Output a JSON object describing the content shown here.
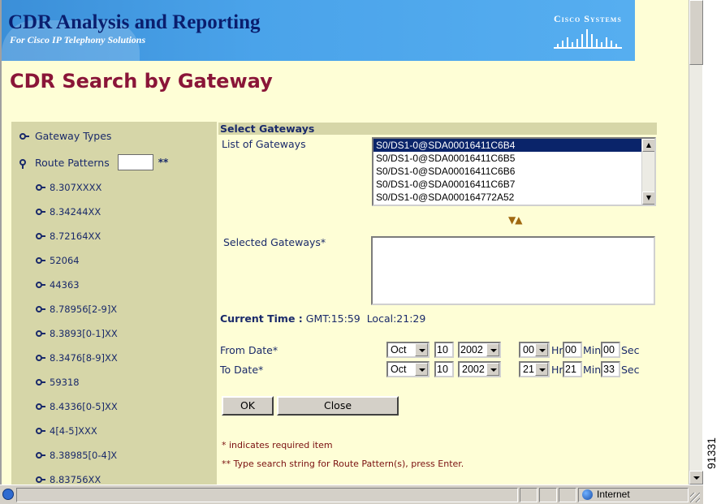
{
  "banner": {
    "title": "CDR Analysis and Reporting",
    "subtitle": "For Cisco IP Telephony Solutions",
    "logo_text": "Cisco Systems"
  },
  "page_title": "CDR Search by Gateway",
  "left_nav": {
    "gateway_types": "Gateway Types",
    "route_patterns": "Route Patterns",
    "route_pattern_input_value": "",
    "route_pattern_marker": "**",
    "patterns": [
      "8.307XXXX",
      "8.34244XX",
      "8.72164XX",
      "52064",
      "44363",
      "8.78956[2-9]X",
      "8.3893[0-1]XX",
      "8.3476[8-9]XX",
      "59318",
      "8.4336[0-5]XX",
      "4[4-5]XXX",
      "8.38985[0-4]X",
      "8.83756XX"
    ]
  },
  "main": {
    "section_title": "Select Gateways",
    "list_label": "List of Gateways",
    "gateways": [
      "S0/DS1-0@SDA00016411C6B4",
      "S0/DS1-0@SDA00016411C6B5",
      "S0/DS1-0@SDA00016411C6B6",
      "S0/DS1-0@SDA00016411C6B7",
      "S0/DS1-0@SDA000164772A52"
    ],
    "selected_index": 0,
    "selected_label": "Selected Gateways*",
    "current_time_label": "Current Time :",
    "gmt_time": "GMT:15:59",
    "local_time": "Local:21:29",
    "from_date": {
      "label": "From Date*",
      "month": "Oct",
      "day": "10",
      "year": "2002",
      "hour": "00",
      "minute": "00",
      "second": "00"
    },
    "to_date": {
      "label": "To Date*",
      "month": "Oct",
      "day": "10",
      "year": "2002",
      "hour": "21",
      "minute": "21",
      "second": "33"
    },
    "units": {
      "hr": "Hr",
      "min": "Min",
      "sec": "Sec"
    },
    "ok_button": "OK",
    "close_button": "Close",
    "note_required": "* indicates required item",
    "note_route": "** Type search string for Route Pattern(s), press Enter."
  },
  "status_bar": {
    "zone": "Internet"
  },
  "figure_id": "91331",
  "colors": {
    "page_bg": "#fefed6",
    "panel_bg": "#d6d6a8",
    "banner_blue": "#4aa3ea",
    "title_maroon": "#8a1538",
    "text_navy": "#1a2a6a"
  }
}
